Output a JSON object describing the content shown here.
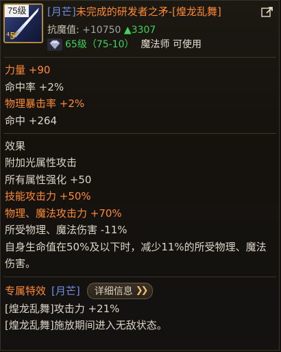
{
  "item": {
    "level_tag": "75级",
    "stars": "⁴5",
    "set_tag": "[月芒]",
    "name": "未完成的研发者之矛-[煌龙乱舞]",
    "resist_label": "抗魔值: ",
    "resist_base": "+10750",
    "resist_up": "▲3307",
    "level_req": "65级（75-10）",
    "class_req": "魔法师 可使用"
  },
  "stats": [
    {
      "label": "力量",
      "value": " +90",
      "color": "orange"
    },
    {
      "label": "命中率",
      "value": " +2%",
      "color": "white"
    },
    {
      "label": "物理暴击率",
      "value": " +2%",
      "color": "orange"
    },
    {
      "label": "命中",
      "value": " +264",
      "color": "white"
    }
  ],
  "effects": {
    "heading": "效果",
    "lines": [
      {
        "text": "附加光属性攻击",
        "color": "white"
      },
      {
        "text": "所有属性强化 +50",
        "color": "white"
      },
      {
        "text": "技能攻击力 +50%",
        "color": "orange"
      },
      {
        "text": "物理、魔法攻击力 +70%",
        "color": "orange"
      },
      {
        "text": "所受物理、魔法伤害 -11%",
        "color": "white"
      },
      {
        "text": "自身生命值在50%及以下时，减少11%的所受物理、魔法伤害。",
        "color": "white"
      }
    ]
  },
  "exclusive": {
    "label": "专属特效",
    "set_tag": "[月芒]",
    "detail_button": "详细信息",
    "lines": [
      "[煌龙乱舞]攻击力 +21%",
      "[煌龙乱舞]施放期间进入无敌状态。"
    ]
  },
  "colors": {
    "orange": "#ff8a33",
    "blue": "#6f8fe0",
    "green": "#3fd35a",
    "text": "#ddd6c8",
    "frame_gold": "#b28c3a"
  },
  "icons": {
    "item": "spear-icon",
    "share": "share-icon",
    "gem": "gem-icon",
    "detail": "double-chevron-right-icon"
  }
}
